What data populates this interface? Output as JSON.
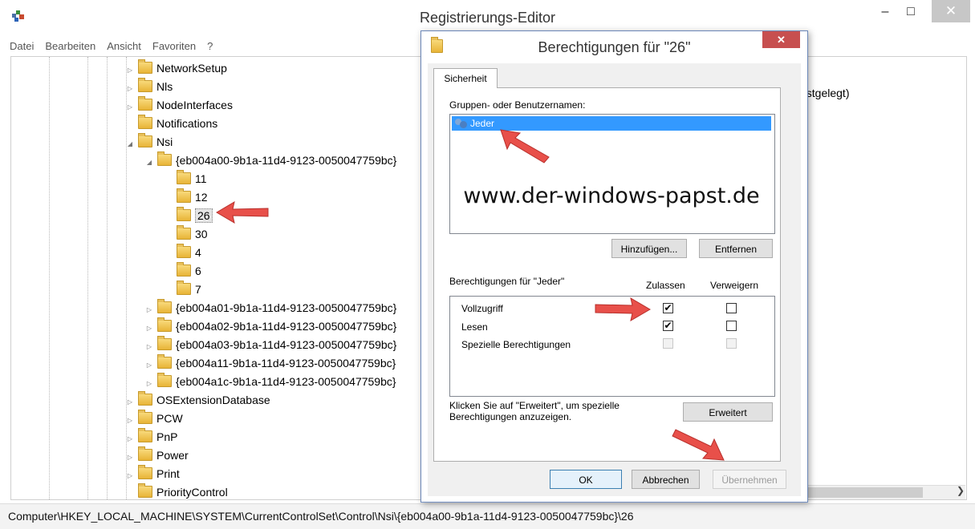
{
  "main_window": {
    "title": "Registrierungs-Editor",
    "controls": {
      "minimize": "–",
      "maximize": "□",
      "close": "✕"
    }
  },
  "menu": [
    "Datei",
    "Bearbeiten",
    "Ansicht",
    "Favoriten",
    "?"
  ],
  "tree": {
    "items": [
      {
        "label": "NetworkSetup",
        "level": 0,
        "expander": "▷"
      },
      {
        "label": "Nls",
        "level": 0,
        "expander": "▷"
      },
      {
        "label": "NodeInterfaces",
        "level": 0,
        "expander": "▷"
      },
      {
        "label": "Notifications",
        "level": 0,
        "expander": ""
      },
      {
        "label": "Nsi",
        "level": 0,
        "expander": "◢"
      },
      {
        "label": "{eb004a00-9b1a-11d4-9123-0050047759bc}",
        "level": 1,
        "expander": "◢"
      },
      {
        "label": "11",
        "level": 2,
        "expander": ""
      },
      {
        "label": "12",
        "level": 2,
        "expander": ""
      },
      {
        "label": "26",
        "level": 2,
        "expander": "",
        "selected": true
      },
      {
        "label": "30",
        "level": 2,
        "expander": ""
      },
      {
        "label": "4",
        "level": 2,
        "expander": ""
      },
      {
        "label": "6",
        "level": 2,
        "expander": ""
      },
      {
        "label": "7",
        "level": 2,
        "expander": ""
      },
      {
        "label": "{eb004a01-9b1a-11d4-9123-0050047759bc}",
        "level": 1,
        "expander": "▷"
      },
      {
        "label": "{eb004a02-9b1a-11d4-9123-0050047759bc}",
        "level": 1,
        "expander": "▷"
      },
      {
        "label": "{eb004a03-9b1a-11d4-9123-0050047759bc}",
        "level": 1,
        "expander": "▷"
      },
      {
        "label": "{eb004a11-9b1a-11d4-9123-0050047759bc}",
        "level": 1,
        "expander": "▷"
      },
      {
        "label": "{eb004a1c-9b1a-11d4-9123-0050047759bc}",
        "level": 1,
        "expander": "▷"
      },
      {
        "label": "OSExtensionDatabase",
        "level": 0,
        "expander": "▷"
      },
      {
        "label": "PCW",
        "level": 0,
        "expander": "▷"
      },
      {
        "label": "PnP",
        "level": 0,
        "expander": "▷"
      },
      {
        "label": "Power",
        "level": 0,
        "expander": "▷"
      },
      {
        "label": "Print",
        "level": 0,
        "expander": "▷"
      },
      {
        "label": "PriorityControl",
        "level": 0,
        "expander": ""
      }
    ]
  },
  "right_pane": {
    "partial_text": "estgelegt)"
  },
  "status_bar": {
    "path": "Computer\\HKEY_LOCAL_MACHINE\\SYSTEM\\CurrentControlSet\\Control\\Nsi\\{eb004a00-9b1a-11d4-9123-0050047759bc}\\26"
  },
  "dialog": {
    "title": "Berechtigungen für \"26\"",
    "close": "✕",
    "tab": "Sicherheit",
    "groups_label": "Gruppen- oder Benutzernamen:",
    "groups": [
      {
        "name": "Jeder",
        "selected": true
      }
    ],
    "watermark": "www.der-windows-papst.de",
    "add_button": "Hinzufügen...",
    "remove_button": "Entfernen",
    "permissions_label": "Berechtigungen für \"Jeder\"",
    "col_allow": "Zulassen",
    "col_deny": "Verweigern",
    "permissions": [
      {
        "name": "Vollzugriff",
        "allow": true,
        "deny": false,
        "disabled": false
      },
      {
        "name": "Lesen",
        "allow": true,
        "deny": false,
        "disabled": false
      },
      {
        "name": "Spezielle Berechtigungen",
        "allow": false,
        "deny": false,
        "disabled": true
      }
    ],
    "info_text": "Klicken Sie auf \"Erweitert\", um spezielle Berechtigungen anzuzeigen.",
    "advanced_button": "Erweitert",
    "ok_button": "OK",
    "cancel_button": "Abbrechen",
    "apply_button": "Übernehmen",
    "apply_disabled": true
  },
  "colors": {
    "selection": "#3399ff",
    "annotation_arrow": "#e8504a",
    "dialog_close": "#c74f4f"
  }
}
